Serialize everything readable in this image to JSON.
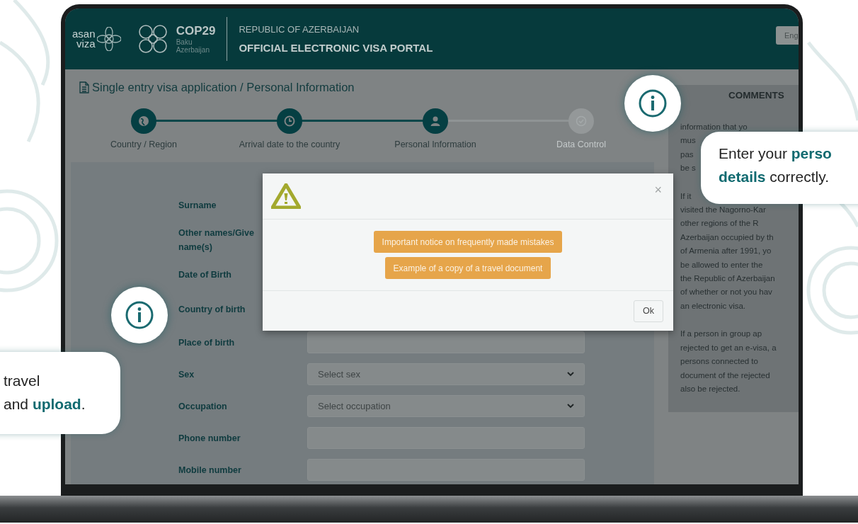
{
  "header": {
    "brand": {
      "line_1": "asan",
      "line_2": "viza"
    },
    "event": {
      "title": "COP29",
      "line_1": "Baku",
      "line_2": "Azerbaijan"
    },
    "country": "REPUBLIC OF AZERBAIJAN",
    "portal": "OFFICIAL ELECTRONIC VISA PORTAL",
    "language_button": "Eng"
  },
  "page_title": "Single entry visa application / Personal Information",
  "steps": [
    {
      "label": "Country / Region",
      "done": true
    },
    {
      "label": "Arrival date to the country",
      "done": true
    },
    {
      "label": "Personal Information",
      "done": true
    },
    {
      "label": "Data Control",
      "done": false
    }
  ],
  "form": {
    "rows": [
      {
        "label": "Surname",
        "kind": "label"
      },
      {
        "label": "Other names/Give name(s)",
        "kind": "label"
      },
      {
        "label": "Date of Birth",
        "kind": "label"
      },
      {
        "label": "Country of birth",
        "kind": "label"
      },
      {
        "label": "Place of birth",
        "kind": "text"
      },
      {
        "label": "Sex",
        "kind": "select",
        "placeholder": "Select sex"
      },
      {
        "label": "Occupation",
        "kind": "select",
        "placeholder": "Select occupation"
      },
      {
        "label": "Phone number",
        "kind": "text"
      },
      {
        "label": "Mobile number",
        "kind": "text"
      }
    ]
  },
  "comments": {
    "title": "COMMENTS",
    "paragraphs": [
      [
        "information that yo",
        "mus",
        "pas",
        "be s"
      ],
      [
        "If it",
        "visited the Nagorno-Kar",
        "other regions of the R",
        "Azerbaijan occupied by th",
        "of Armenia after 1991, yo",
        "be allowed to enter the",
        "the Republic of Azerbaijan",
        "of whether or not you hav",
        "an electronic visa."
      ],
      [
        "If a person in group ap",
        "rejected to get an e-visa, a",
        "persons connected to",
        "document of the rejected",
        "also be rejected."
      ]
    ]
  },
  "dialog": {
    "close": "×",
    "buttons": [
      "Important notice on frequently made mistakes",
      "Example of a copy of a travel document"
    ],
    "ok": "Ok"
  },
  "callouts": [
    {
      "text": "Enter your **perso**\n**details** correctly."
    },
    {
      "text": "travel\nand **upload**."
    }
  ]
}
